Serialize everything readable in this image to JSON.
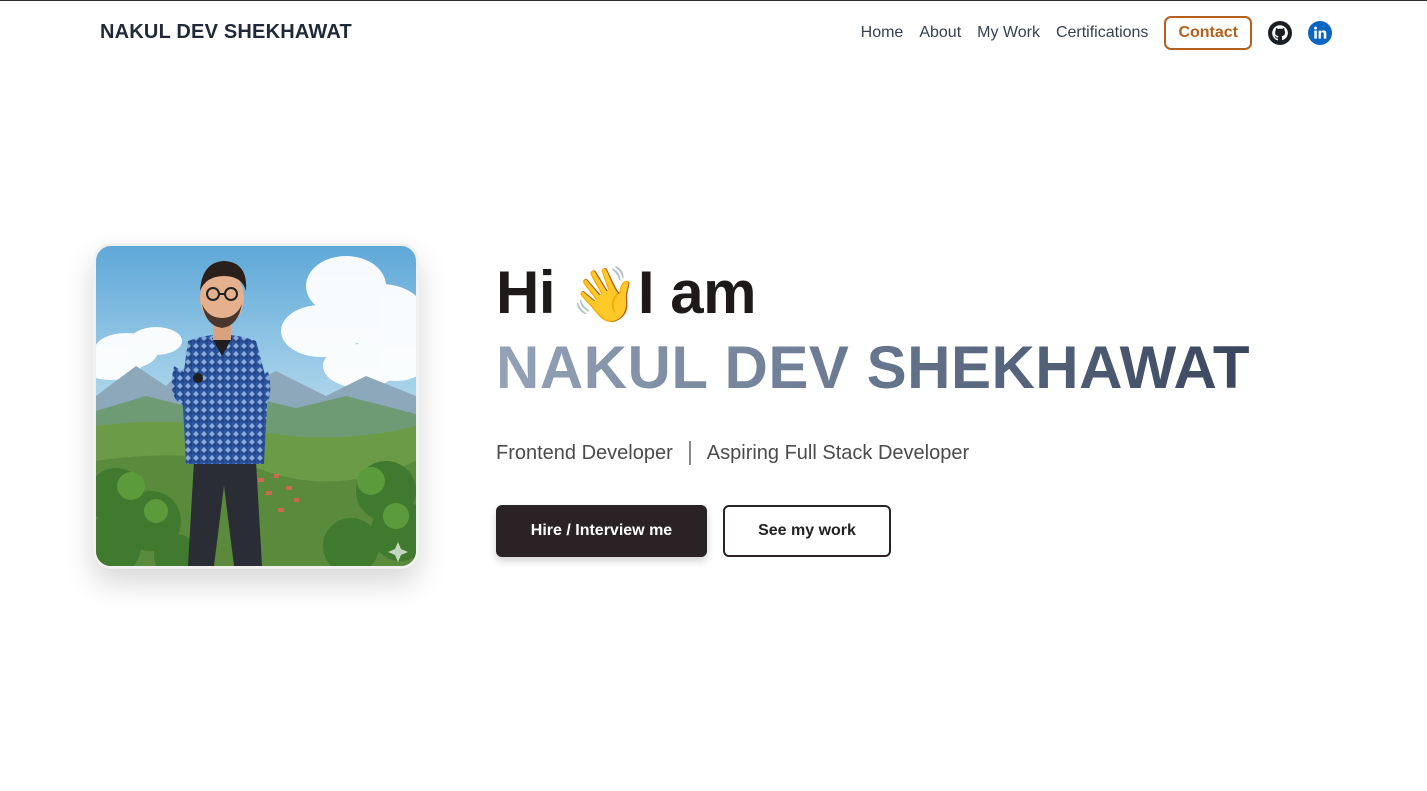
{
  "header": {
    "brand": "NAKUL DEV SHEKHAWAT",
    "nav": [
      {
        "label": "Home"
      },
      {
        "label": "About"
      },
      {
        "label": "My Work"
      },
      {
        "label": "Certifications"
      }
    ],
    "contact_label": "Contact",
    "social": [
      {
        "icon": "github-icon"
      },
      {
        "icon": "linkedin-icon"
      }
    ]
  },
  "hero": {
    "greeting_prefix": "Hi",
    "wave": "👋",
    "greeting_suffix": "I am",
    "name": "NAKUL DEV SHEKHAWAT",
    "roles": [
      "Frontend Developer",
      "Aspiring Full Stack Developer"
    ],
    "primary_cta": "Hire / Interview me",
    "secondary_cta": "See my work"
  },
  "colors": {
    "accent": "#b45f1c",
    "primary_button": "#2a2224",
    "linkedin": "#0a66c2",
    "name_gradient_start": "#95a3b8",
    "name_gradient_end": "#2b3850"
  }
}
